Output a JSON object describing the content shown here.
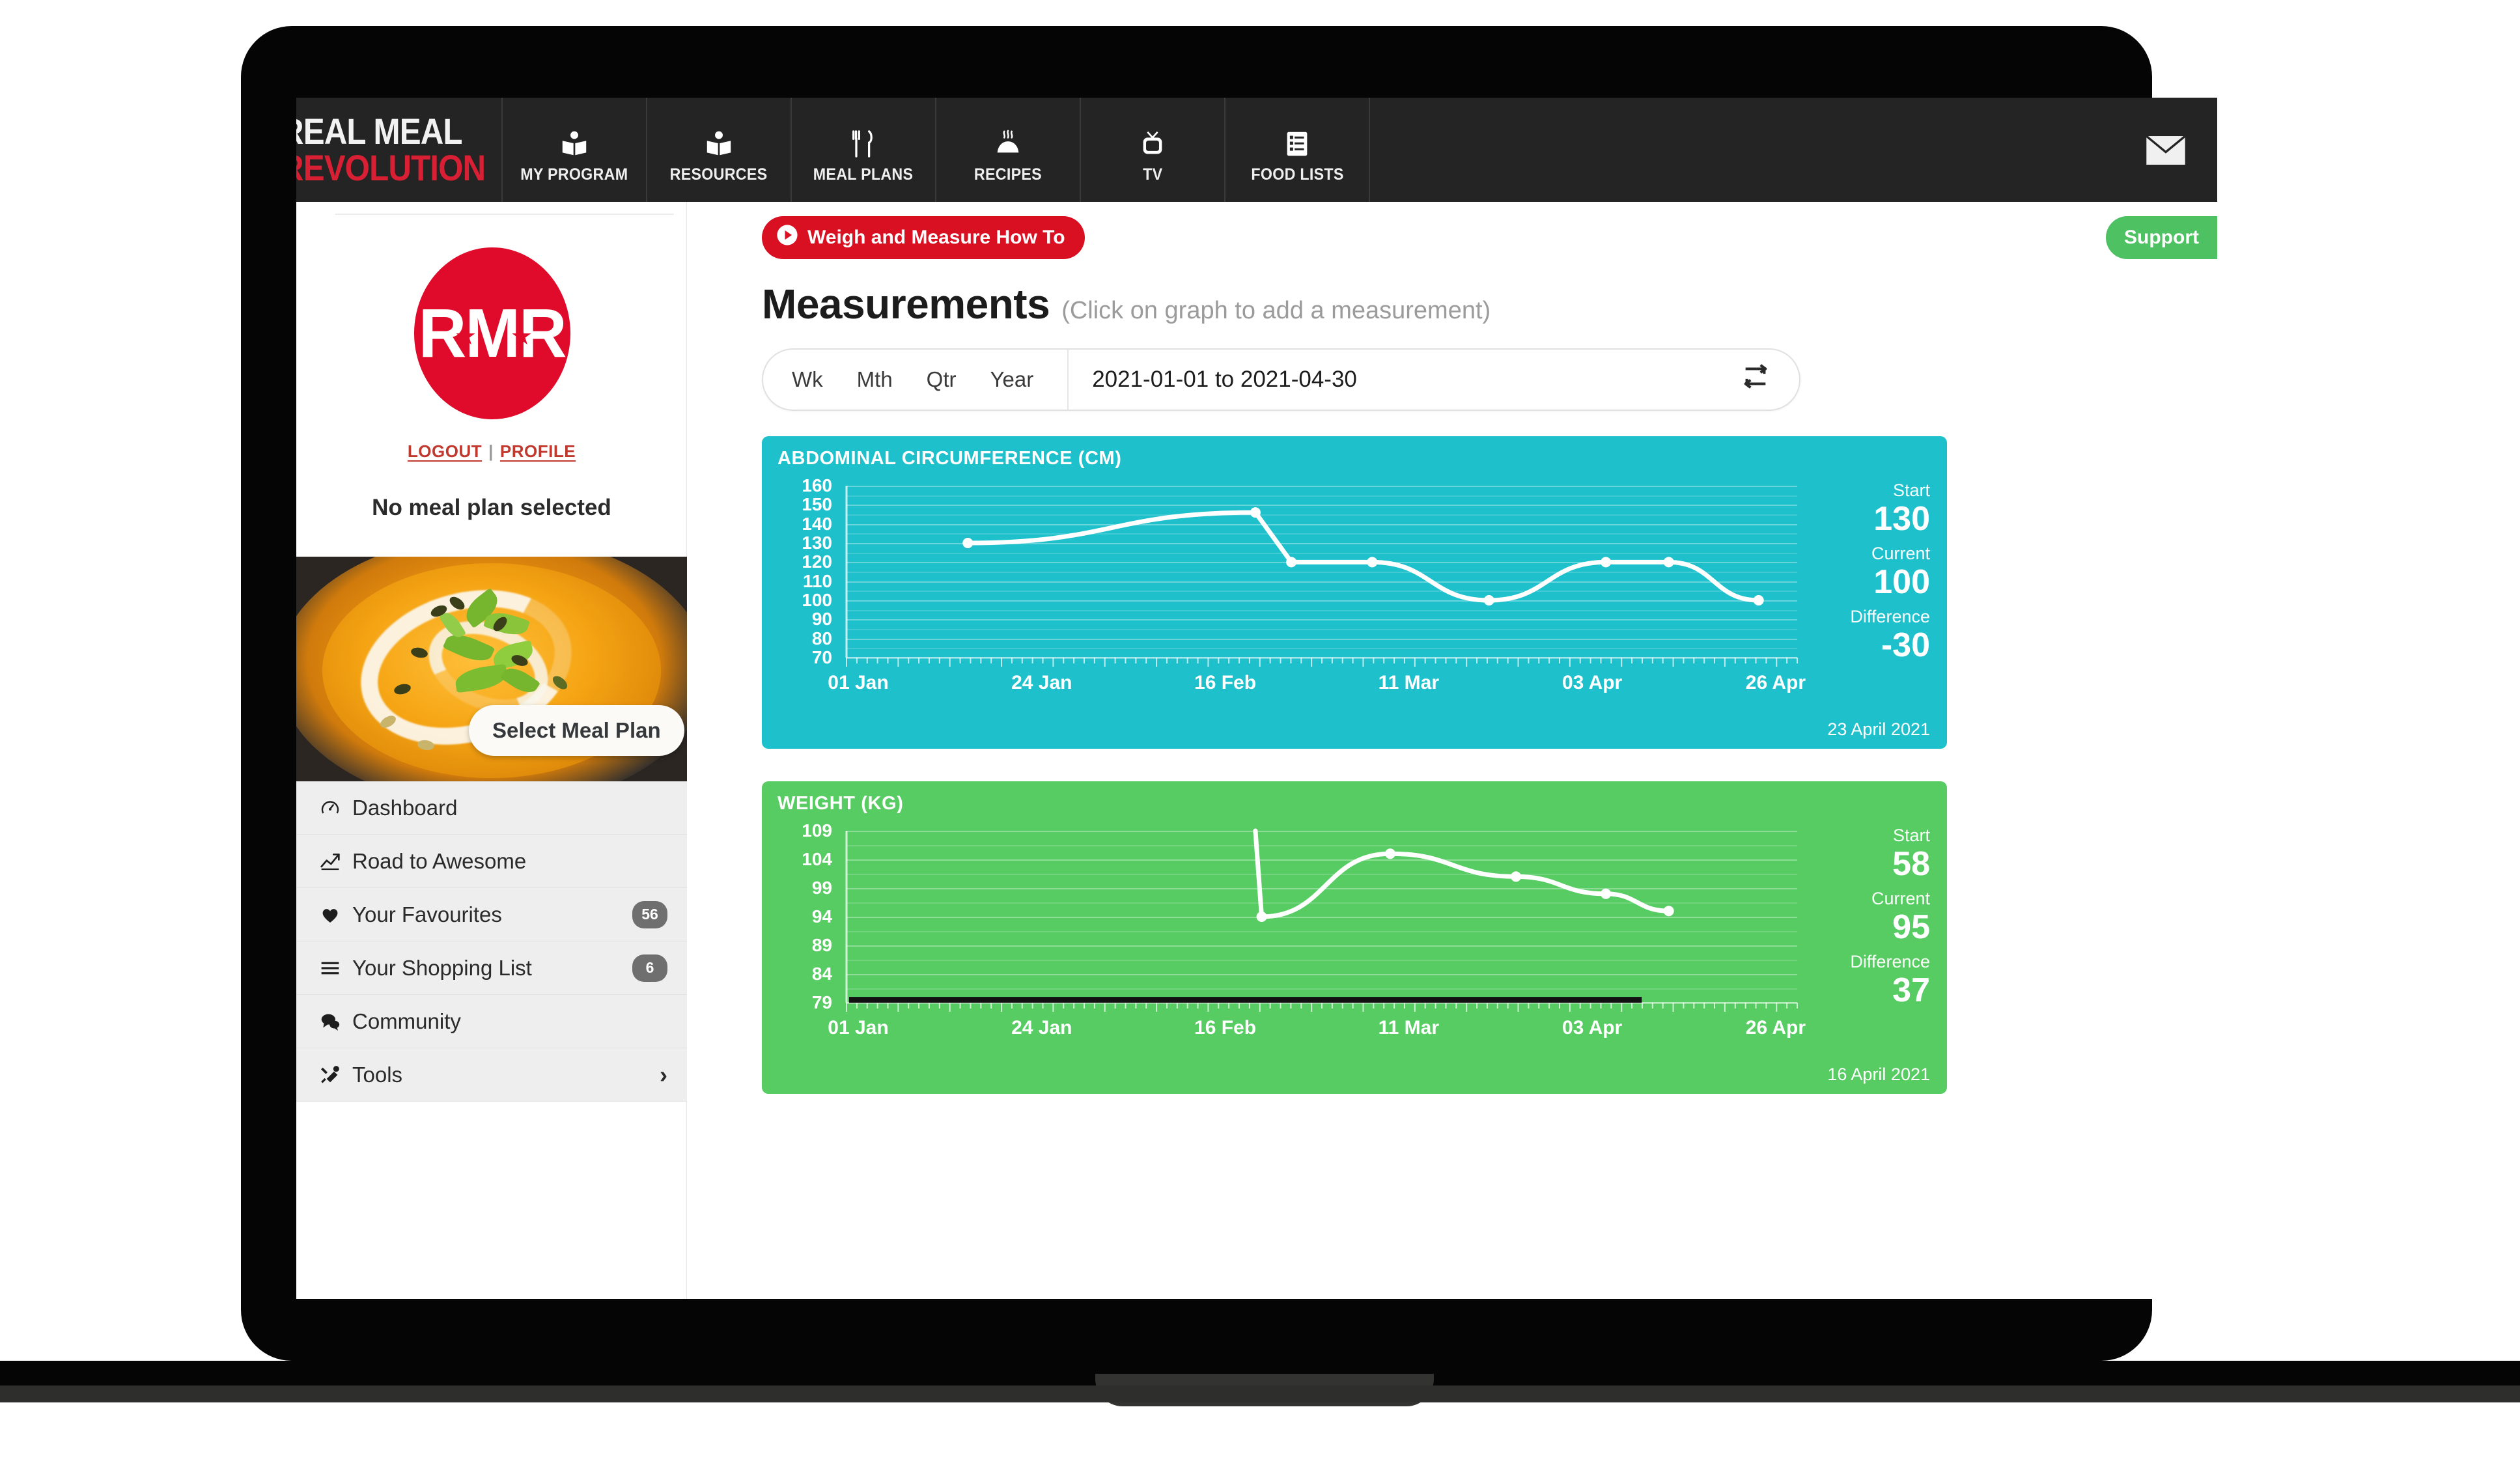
{
  "brand": {
    "line1": "REAL MEAL",
    "line2": "REVOLUTION"
  },
  "topnav": {
    "items": [
      {
        "label": "MY PROGRAM",
        "icon": "open-book-person-icon"
      },
      {
        "label": "RESOURCES",
        "icon": "open-book-person-icon"
      },
      {
        "label": "MEAL PLANS",
        "icon": "fork-knife-icon"
      },
      {
        "label": "RECIPES",
        "icon": "steaming-dish-icon"
      },
      {
        "label": "TV",
        "icon": "television-icon"
      },
      {
        "label": "FOOD LISTS",
        "icon": "list-document-icon"
      }
    ],
    "mail_icon": "envelope-icon"
  },
  "sidebar": {
    "logo_text": "RMR",
    "logout_label": "LOGOUT",
    "separator": "|",
    "profile_label": "PROFILE",
    "no_meal_plan": "No meal plan selected",
    "select_meal_plan": "Select Meal Plan",
    "menu": [
      {
        "label": "Dashboard",
        "icon": "speedometer-icon",
        "badge": null,
        "chevron": false
      },
      {
        "label": "Road to Awesome",
        "icon": "trend-chart-icon",
        "badge": null,
        "chevron": false
      },
      {
        "label": "Your Favourites",
        "icon": "heart-icon",
        "badge": "56",
        "chevron": false
      },
      {
        "label": "Your Shopping List",
        "icon": "list-lines-icon",
        "badge": "6",
        "chevron": false
      },
      {
        "label": "Community",
        "icon": "chat-bubbles-icon",
        "badge": null,
        "chevron": false
      },
      {
        "label": "Tools",
        "icon": "wrench-screwdriver-icon",
        "badge": null,
        "chevron": true
      }
    ]
  },
  "main": {
    "howto_button": "Weigh and Measure How To",
    "howto_icon": "play-circle-icon",
    "support_button": "Support",
    "title": "Measurements",
    "subtitle": "(Click on graph to add a measurement)",
    "range": {
      "tabs": [
        "Wk",
        "Mth",
        "Qtr",
        "Year"
      ],
      "value": "2021-01-01 to 2021-04-30",
      "refresh_icon": "refresh-icon"
    }
  },
  "colors": {
    "brand_red": "#d81f34",
    "abdominal_teal": "#1ec0cc",
    "weight_green": "#56cc63",
    "support_green": "#4ec263",
    "howto_red": "#d90f22",
    "nav_dark": "#242424"
  },
  "chart_data": [
    {
      "type": "line",
      "title": "ABDOMINAL CIRCUMFERENCE (CM)",
      "xlabel": "",
      "ylabel": "cm",
      "ylim": [
        70,
        160
      ],
      "yticks": [
        160,
        150,
        140,
        130,
        120,
        110,
        100,
        90,
        80,
        70
      ],
      "xticks": [
        "01 Jan",
        "24 Jan",
        "16 Feb",
        "11 Mar",
        "03 Apr",
        "26 Apr"
      ],
      "grid": true,
      "legend": "none",
      "x": [
        "24 Jan",
        "01 Mar",
        "08 Mar",
        "18 Mar",
        "31 Mar",
        "10 Apr",
        "16 Apr",
        "23 Apr"
      ],
      "values": [
        130,
        146,
        120,
        120,
        100,
        120,
        120,
        100
      ],
      "stats": {
        "start_label": "Start",
        "start_value": "130",
        "current_label": "Current",
        "current_value": "100",
        "difference_label": "Difference",
        "difference_value": "-30",
        "date": "23 April 2021"
      }
    },
    {
      "type": "line",
      "title": "WEIGHT (KG)",
      "xlabel": "",
      "ylabel": "kg",
      "ylim": [
        79,
        109
      ],
      "yticks": [
        109,
        104,
        99,
        94,
        89,
        84,
        79
      ],
      "xticks": [
        "01 Jan",
        "24 Jan",
        "16 Feb",
        "11 Mar",
        "03 Apr",
        "26 Apr"
      ],
      "grid": true,
      "legend": "none",
      "x": [
        "28 Feb",
        "01 Mar",
        "13 Mar",
        "27 Mar",
        "07 Apr",
        "16 Apr"
      ],
      "values": [
        109,
        94,
        105,
        101,
        98,
        95
      ],
      "goal_line_value": 79.5,
      "stats": {
        "start_label": "Start",
        "start_value": "58",
        "current_label": "Current",
        "current_value": "95",
        "difference_label": "Difference",
        "difference_value": "37",
        "date": "16 April 2021"
      }
    }
  ]
}
